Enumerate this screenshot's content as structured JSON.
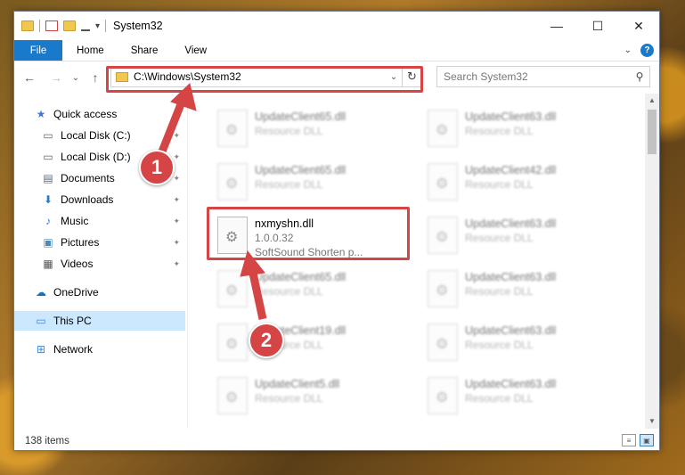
{
  "window": {
    "title": "System32",
    "controls": {
      "minimize": "—",
      "maximize": "☐",
      "close": "✕"
    }
  },
  "ribbon": {
    "tabs": [
      "File",
      "Home",
      "Share",
      "View"
    ],
    "help": "?"
  },
  "navigation": {
    "back": "←",
    "forward": "→",
    "recent": "⌄",
    "up": "↑",
    "address": "C:\\Windows\\System32",
    "search_placeholder": "Search System32"
  },
  "sidebar": {
    "items": [
      {
        "label": "Quick access",
        "icon": "star-icon",
        "glyph": "★",
        "color": "#3a7bd5",
        "pinned": false
      },
      {
        "label": "Local Disk (C:)",
        "icon": "drive-icon",
        "glyph": "▭",
        "color": "#666",
        "pinned": true
      },
      {
        "label": "Local Disk (D:)",
        "icon": "drive-icon",
        "glyph": "▭",
        "color": "#666",
        "pinned": true
      },
      {
        "label": "Documents",
        "icon": "document-icon",
        "glyph": "▤",
        "color": "#5a6a80",
        "pinned": true
      },
      {
        "label": "Downloads",
        "icon": "download-icon",
        "glyph": "⬇",
        "color": "#2a7ad5",
        "pinned": true
      },
      {
        "label": "Music",
        "icon": "music-icon",
        "glyph": "♪",
        "color": "#2a7ad5",
        "pinned": true
      },
      {
        "label": "Pictures",
        "icon": "pictures-icon",
        "glyph": "▣",
        "color": "#4a8ab5",
        "pinned": true
      },
      {
        "label": "Videos",
        "icon": "video-icon",
        "glyph": "▦",
        "color": "#555",
        "pinned": true
      },
      {
        "label": "OneDrive",
        "icon": "cloud-icon",
        "glyph": "☁",
        "color": "#1a6fc2",
        "pinned": false
      },
      {
        "label": "This PC",
        "icon": "computer-icon",
        "glyph": "▭",
        "color": "#3a8ad5",
        "pinned": false,
        "selected": true
      },
      {
        "label": "Network",
        "icon": "network-icon",
        "glyph": "⊞",
        "color": "#3a8ad5",
        "pinned": false
      }
    ],
    "pin_glyph": "📌"
  },
  "files": {
    "column_left": [
      {
        "name": "UpdateClient65.dll",
        "sub": "Resource DLL",
        "blur": true
      },
      {
        "name": "UpdateClient65.dll",
        "sub": "Resource DLL",
        "blur": true
      },
      {
        "name": "nxmyshn.dll",
        "version": "1.0.0.32",
        "sub": "SoftSound Shorten p...",
        "blur": false
      },
      {
        "name": "UpdateClient65.dll",
        "sub": "Resource DLL",
        "blur": true
      },
      {
        "name": "UpdateClient19.dll",
        "sub": "Resource DLL",
        "blur": true
      },
      {
        "name": "UpdateClient5.dll",
        "sub": "Resource DLL",
        "blur": true
      }
    ],
    "column_right": [
      {
        "name": "UpdateClient63.dll",
        "sub": "Resource DLL",
        "blur": true
      },
      {
        "name": "UpdateClient42.dll",
        "sub": "Resource DLL",
        "blur": true
      },
      {
        "name": "UpdateClient63.dll",
        "sub": "Resource DLL",
        "blur": true
      },
      {
        "name": "UpdateClient63.dll",
        "sub": "Resource DLL",
        "blur": true
      },
      {
        "name": "UpdateClient63.dll",
        "sub": "Resource DLL",
        "blur": true
      },
      {
        "name": "UpdateClient63.dll",
        "sub": "Resource DLL",
        "blur": true
      }
    ]
  },
  "status": {
    "item_count": "138 items"
  },
  "callouts": {
    "one": "1",
    "two": "2"
  },
  "colors": {
    "accent": "#1979ca",
    "highlight": "#d64545",
    "selected": "#cce8ff"
  }
}
